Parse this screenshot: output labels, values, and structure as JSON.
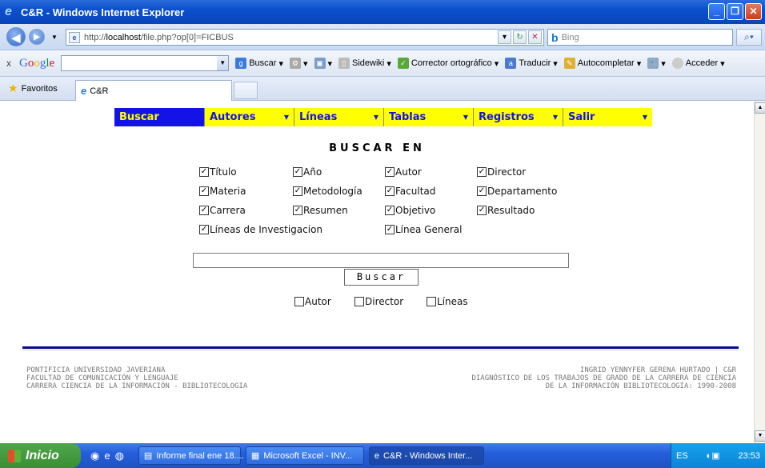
{
  "window": {
    "title": "C&R - Windows Internet Explorer"
  },
  "addressbar": {
    "url_prefix": "http://",
    "url_host": "localhost",
    "url_path": "/file.php?op[0]=FICBUS",
    "search_placeholder": "Bing"
  },
  "google_toolbar": {
    "buscar_label": "Buscar",
    "sidewiki_label": "Sidewiki",
    "corrector_label": "Corrector ortográfico",
    "traducir_label": "Traducir",
    "autocompletar_label": "Autocompletar",
    "acceder_label": "Acceder"
  },
  "tabs": {
    "favorites_label": "Favoritos",
    "active_tab_label": "C&R"
  },
  "menu": {
    "items": [
      {
        "label": "Buscar"
      },
      {
        "label": "Autores"
      },
      {
        "label": "Líneas"
      },
      {
        "label": "Tablas"
      },
      {
        "label": "Registros"
      },
      {
        "label": "Salir"
      }
    ]
  },
  "search": {
    "heading": "BUSCAR EN",
    "fields": [
      {
        "label": "Título",
        "checked": true
      },
      {
        "label": "Año",
        "checked": true
      },
      {
        "label": "Autor",
        "checked": true
      },
      {
        "label": "Director",
        "checked": true
      },
      {
        "label": "Materia",
        "checked": true
      },
      {
        "label": "Metodología",
        "checked": true
      },
      {
        "label": "Facultad",
        "checked": true
      },
      {
        "label": "Departamento",
        "checked": true
      },
      {
        "label": "Carrera",
        "checked": true
      },
      {
        "label": "Resumen",
        "checked": true
      },
      {
        "label": "Objetivo",
        "checked": true
      },
      {
        "label": "Resultado",
        "checked": true
      },
      {
        "label": "Líneas de Investigacion",
        "checked": true
      },
      {
        "label": "Línea General",
        "checked": true
      }
    ],
    "query_value": "",
    "button_label": "Buscar",
    "filters": [
      {
        "label": "Autor",
        "checked": false
      },
      {
        "label": "Director",
        "checked": false
      },
      {
        "label": "Líneas",
        "checked": false
      }
    ]
  },
  "footer": {
    "left_line1": "PONTIFICIA UNIVERSIDAD JAVERIANA",
    "left_line2": "FACULTAD DE COMUNICACIÓN Y LENGUAJE",
    "left_line3": "CARRERA CIENCIA DE LA INFORMACIÓN - BIBLIOTECOLOGIA",
    "right_line1": "INGRID YENNYFER GERENA HURTADO | C&R",
    "right_line2": "DIAGNÓSTICO DE LOS TRABAJOS DE GRADO DE LA CARRERA DE CIENCIA",
    "right_line3": "DE LA INFORMACIÓN BIBLIOTECOLOGÍA: 1990-2008"
  },
  "taskbar": {
    "start_label": "Inicio",
    "tasks": [
      {
        "label": "Informe final ene 18...."
      },
      {
        "label": "Microsoft Excel - INV..."
      },
      {
        "label": "C&R - Windows Inter..."
      }
    ],
    "language": "ES",
    "clock": "23:53"
  },
  "colors": {
    "menu_active_bg": "#1313e8",
    "menu_bg": "#ffff00",
    "rule": "#0a0a8a"
  }
}
